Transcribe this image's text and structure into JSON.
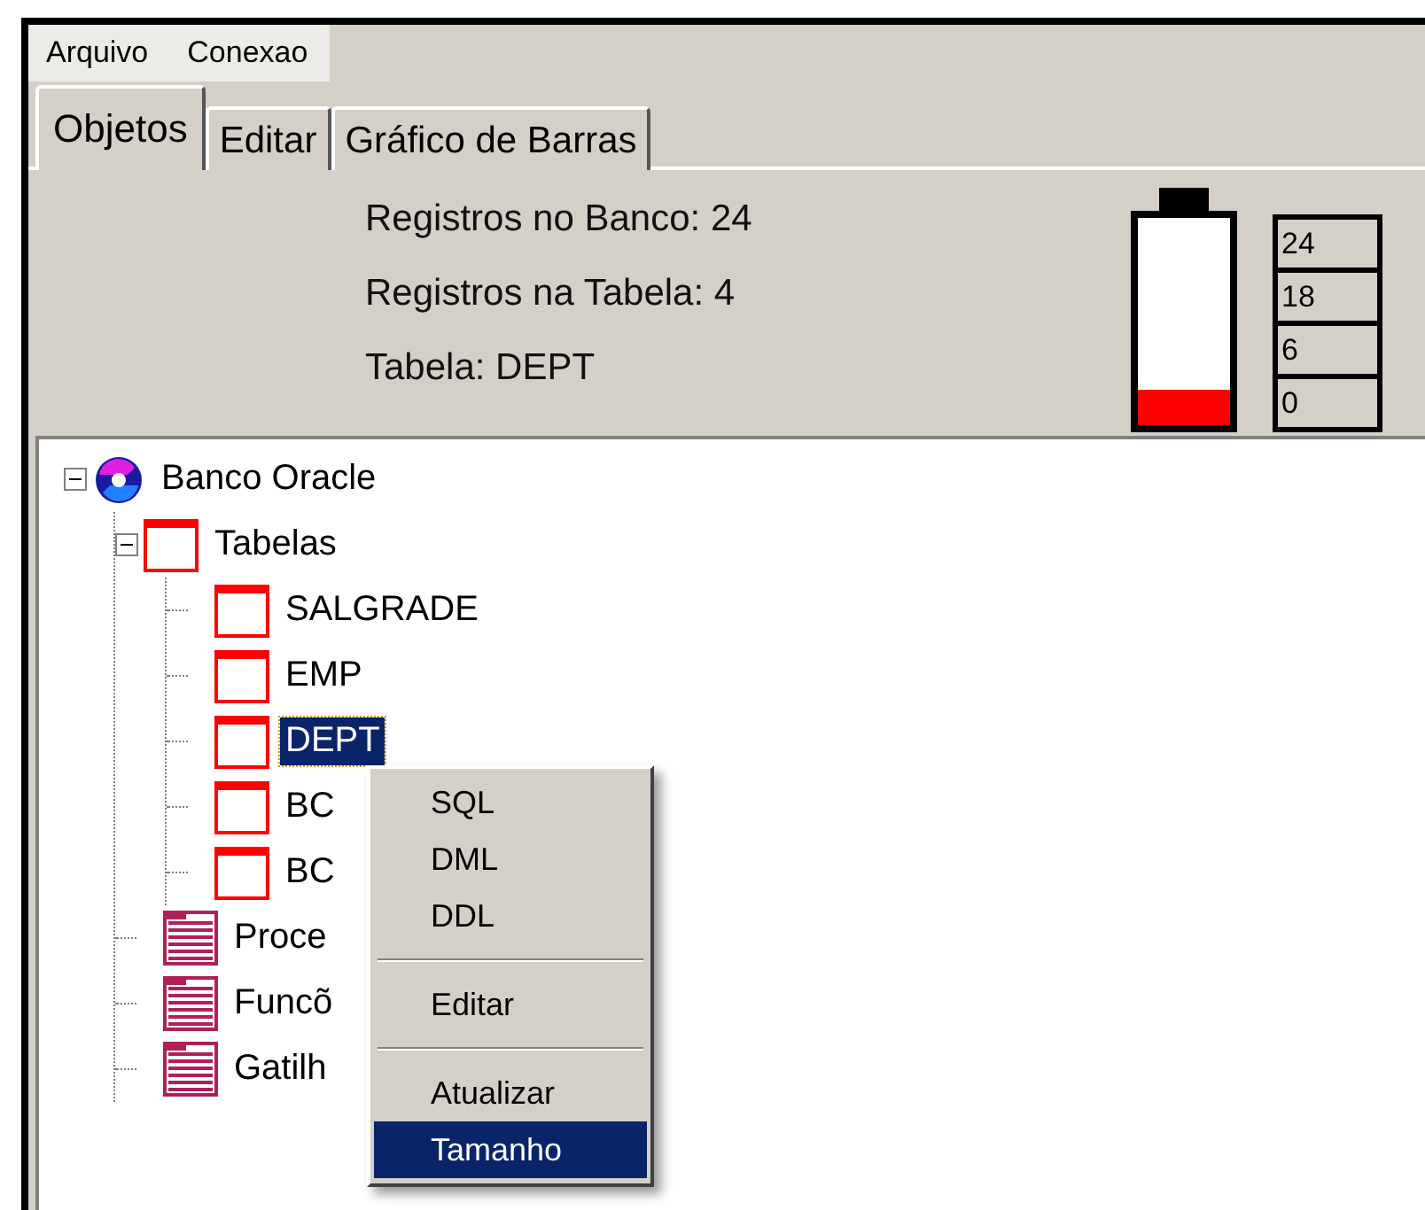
{
  "menu_bar": [
    "Arquivo",
    "Conexao"
  ],
  "tabs": [
    {
      "label": "Objetos",
      "selected": true
    },
    {
      "label": "Editar",
      "selected": false
    },
    {
      "label": "Gráfico de Barras",
      "selected": false
    }
  ],
  "info": [
    {
      "label": "Registros no Banco",
      "value": ": 24"
    },
    {
      "label": "Registros na Tabela",
      "value": ": 4"
    },
    {
      "label": "Tabela",
      "value": ": DEPT"
    }
  ],
  "gauge": {
    "level": 0.17,
    "scale": [
      "24",
      "18",
      "6",
      "0"
    ]
  },
  "tree": [
    {
      "label": "Banco Oracle",
      "kind": "database",
      "expanded": true,
      "selected": false,
      "children": [
        {
          "label": "Tabelas",
          "kind": "table",
          "expanded": true,
          "selected": false,
          "children": [
            {
              "label": "SALGRADE",
              "kind": "table",
              "selected": false
            },
            {
              "label": "EMP",
              "kind": "table",
              "selected": false
            },
            {
              "label": "DEPT",
              "kind": "table",
              "selected": true
            },
            {
              "label": "BC",
              "kind": "table",
              "selected": false
            },
            {
              "label": "BC",
              "kind": "table",
              "selected": false
            }
          ]
        },
        {
          "label": "Proce",
          "kind": "document",
          "selected": false
        },
        {
          "label": "Funcõ",
          "kind": "document",
          "selected": false
        },
        {
          "label": "Gatilh",
          "kind": "document",
          "selected": false
        }
      ]
    }
  ],
  "context_menu": [
    {
      "kind": "item",
      "label": "SQL",
      "selected": false
    },
    {
      "kind": "item",
      "label": "DML",
      "selected": false
    },
    {
      "kind": "item",
      "label": "DDL",
      "selected": false
    },
    {
      "kind": "separator"
    },
    {
      "kind": "item",
      "label": "Editar",
      "selected": false
    },
    {
      "kind": "separator"
    },
    {
      "kind": "item",
      "label": "Atualizar",
      "selected": false
    },
    {
      "kind": "item",
      "label": "Tamanho",
      "selected": true
    }
  ]
}
